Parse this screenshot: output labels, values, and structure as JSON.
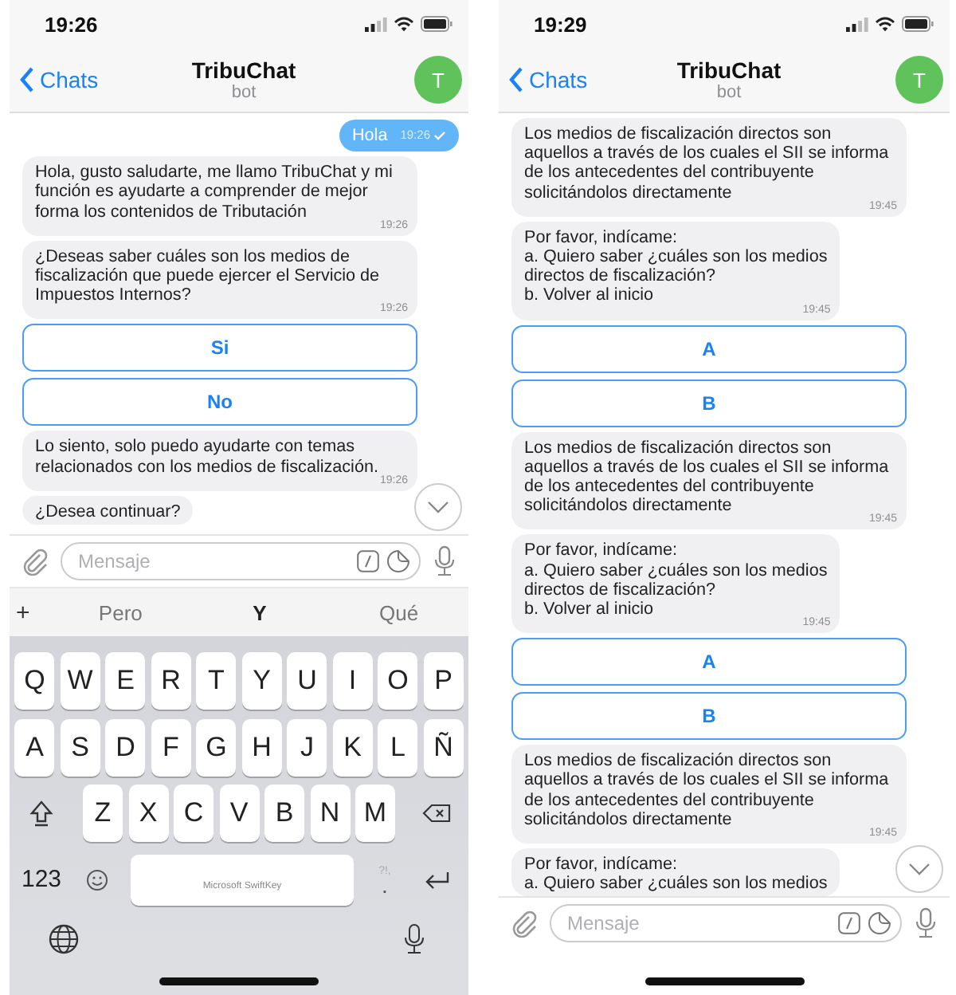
{
  "screens": [
    {
      "status_bar": {
        "time": "19:26"
      },
      "header": {
        "back": "Chats",
        "title": "TribuChat",
        "subtitle": "bot",
        "avatar": "T"
      },
      "messages": [
        {
          "kind": "outgoing",
          "text": "Hola",
          "time": "19:26"
        },
        {
          "kind": "incoming",
          "text": "Hola, gusto saludarte, me llamo TribuChat y mi función es ayudarte a comprender de mejor forma los contenidos de Tributación",
          "time": "19:26"
        },
        {
          "kind": "incoming",
          "text": "¿Deseas saber cuáles son los medios de fiscalización que puede ejercer el Servicio de Impuestos Internos?",
          "time": "19:26"
        },
        {
          "kind": "buttons",
          "buttons": [
            "Si",
            "No"
          ]
        },
        {
          "kind": "incoming",
          "text": "Lo siento, solo puedo ayudarte con temas relacionados con los medios de fiscalización.",
          "time": "19:26"
        },
        {
          "kind": "incoming",
          "text": "¿Desea continuar?"
        }
      ],
      "composer": {
        "placeholder": "Mensaje"
      },
      "keyboard": {
        "plus": "+",
        "suggestions": [
          {
            "text": "Pero",
            "selected": false
          },
          {
            "text": "Y",
            "selected": true
          },
          {
            "text": "Qué",
            "selected": false
          }
        ],
        "rows": [
          [
            "Q",
            "W",
            "E",
            "R",
            "T",
            "Y",
            "U",
            "I",
            "O",
            "P"
          ],
          [
            "A",
            "S",
            "D",
            "F",
            "G",
            "H",
            "J",
            "K",
            "L",
            "Ñ"
          ],
          [
            "Z",
            "X",
            "C",
            "V",
            "B",
            "N",
            "M"
          ]
        ],
        "number_key": "123",
        "space_label": "Microsoft SwiftKey",
        "punctuation_hint": "?!,",
        "punctuation_key": "."
      }
    },
    {
      "status_bar": {
        "time": "19:29"
      },
      "header": {
        "back": "Chats",
        "title": "TribuChat",
        "subtitle": "bot",
        "avatar": "T"
      },
      "messages": [
        {
          "kind": "incoming",
          "text": "Los medios de fiscalización directos son aquellos a través de los cuales el SII se informa de los antecedentes del contribuyente solicitándolos directamente",
          "time": "19:45"
        },
        {
          "kind": "incoming",
          "text": "Por favor, indícame:\na. Quiero saber ¿cuáles son los medios\ndirectos de fiscalización?\nb. Volver al inicio",
          "time": "19:45"
        },
        {
          "kind": "buttons",
          "buttons": [
            "A",
            "B"
          ]
        },
        {
          "kind": "incoming",
          "text": "Los medios de fiscalización directos son aquellos a través de los cuales el SII se informa de los antecedentes del contribuyente solicitándolos directamente",
          "time": "19:45"
        },
        {
          "kind": "incoming",
          "text": "Por favor, indícame:\na. Quiero saber ¿cuáles son los medios\ndirectos de fiscalización?\nb. Volver al inicio",
          "time": "19:45"
        },
        {
          "kind": "buttons",
          "buttons": [
            "A",
            "B"
          ]
        },
        {
          "kind": "incoming",
          "text": "Los medios de fiscalización directos son aquellos a través de los cuales el SII se informa de los antecedentes del contribuyente solicitándolos directamente",
          "time": "19:45"
        },
        {
          "kind": "incoming",
          "text": "Por favor, indícame:\na. Quiero saber ¿cuáles son los medios"
        }
      ],
      "composer": {
        "placeholder": "Mensaje"
      }
    }
  ]
}
